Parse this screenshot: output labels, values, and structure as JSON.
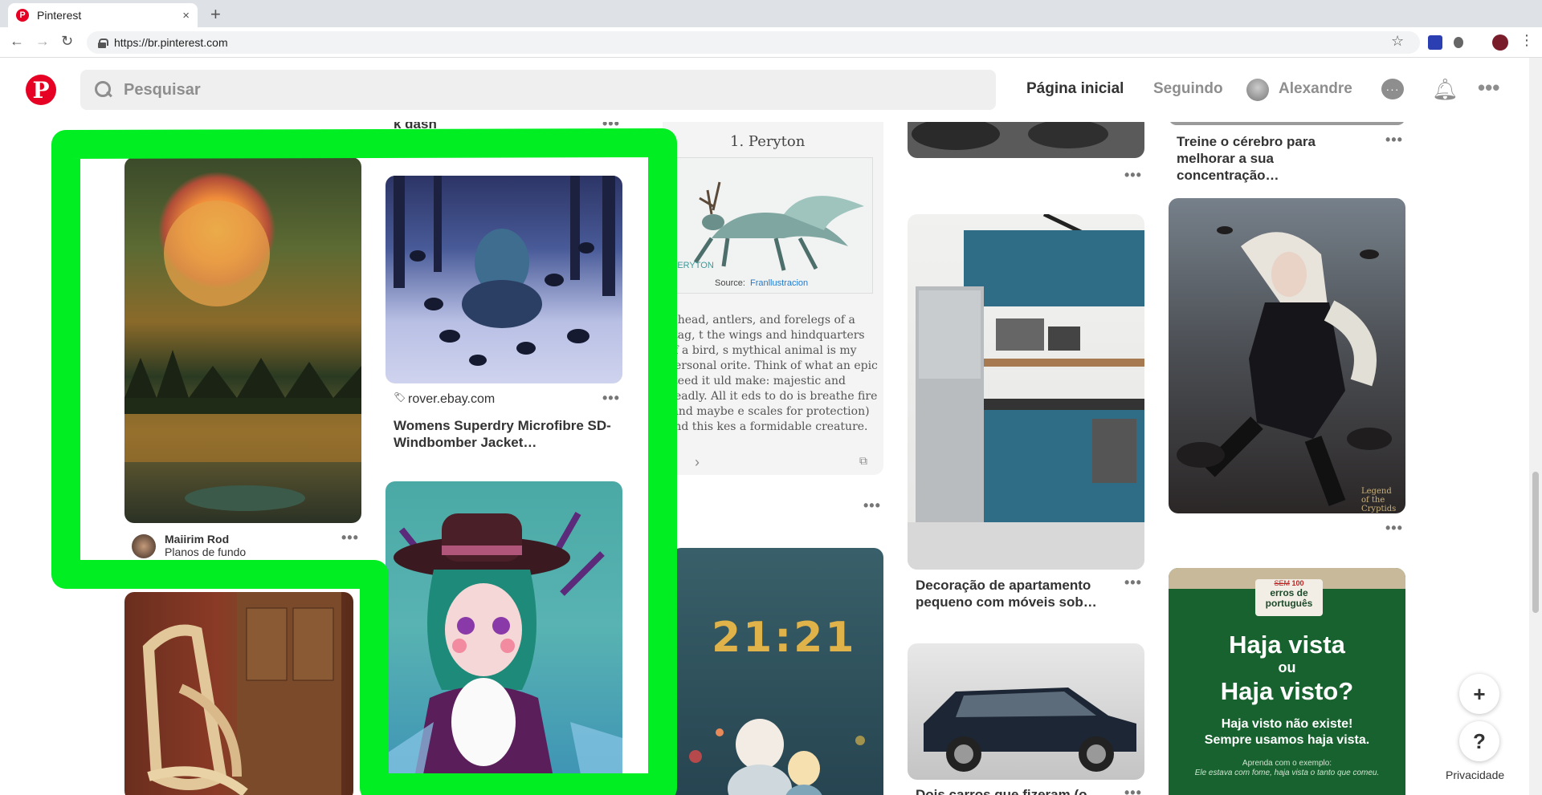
{
  "browser": {
    "tab_title": "Pinterest",
    "tab_close": "×",
    "new_tab": "+",
    "url": "https://br.pinterest.com",
    "icons": [
      "back-icon",
      "forward-icon",
      "reload-icon",
      "lock-icon",
      "star-icon"
    ]
  },
  "header": {
    "logo": "P",
    "search_placeholder": "Pesquisar",
    "home": "Página inicial",
    "following": "Seguindo",
    "user": "Alexandre",
    "more": "•••",
    "colors": {
      "brand": "#e60023",
      "muted": "#8e8e8e",
      "active": "#333333"
    }
  },
  "pins": {
    "col1": {
      "top_author_name": "Maiirim Rod",
      "top_author_board": "Planos de fundo"
    },
    "col2": {
      "partial_title": "k dash",
      "rover_source": "rover.ebay.com",
      "rover_title": "Womens Superdry Microfibre SD-Windbomber Jacket…"
    },
    "col3": {
      "peryton_heading": "1. Peryton",
      "peryton_source_label": "Source:",
      "peryton_source_name": "Franllustracion",
      "peryton_logo": "PERYTON",
      "peryton_text": "e head, antlers, and forelegs of a stag, t the wings and hindquarters of a bird, s mythical animal is my personal orite. Think of what an epic steed it uld make: majestic and deadly. All it eds to do is breathe fire (and maybe e scales for protection) and this kes a formidable creature.",
      "clock": "21:21"
    },
    "col4": {
      "kitchen_title": "Decoração de apartamento pequeno com móveis sob…",
      "cars_title": "Dois carros que fizeram (o…"
    },
    "col5": {
      "brain_title": "Treine o cérebro para melhorar a sua concentração…",
      "legend_label": "Legend of the Cryptids",
      "haja_badge_strike": "SEM",
      "haja_badge_num": "100",
      "haja_badge_text": "erros de português",
      "haja_line1": "Haja vista",
      "haja_ou": "ou",
      "haja_line2": "Haja visto?",
      "haja_sub1": "Haja visto não existe!",
      "haja_sub2": "Sempre usamos haja vista.",
      "haja_small1": "Aprenda com o exemplo:",
      "haja_small2": "Ele estava com fome, haja vista o tanto que comeu."
    },
    "more_dots": "•••"
  },
  "floating": {
    "add": "+",
    "help": "?",
    "privacy": "Privacidade"
  },
  "annotation": {
    "color": "#00ee22"
  }
}
